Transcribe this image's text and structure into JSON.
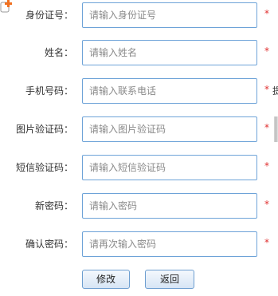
{
  "form": {
    "fields": [
      {
        "label": "身份证号：",
        "placeholder": "请输入身份证号",
        "required": "*"
      },
      {
        "label": "姓名：",
        "placeholder": "请输入姓名",
        "required": "*"
      },
      {
        "label": "手机号码：",
        "placeholder": "请输入联系电话",
        "required": "*",
        "hint": "提"
      },
      {
        "label": "图片验证码：",
        "placeholder": "请输入图片验证码",
        "required": "*"
      },
      {
        "label": "短信验证码：",
        "placeholder": "请输入短信验证码",
        "required": "*"
      },
      {
        "label": "新密码：",
        "placeholder": "请输入密码",
        "required": "*"
      },
      {
        "label": "确认密码：",
        "placeholder": "请再次输入密码",
        "required": "*"
      }
    ]
  },
  "buttons": {
    "submit": "修改",
    "back": "返回"
  },
  "colors": {
    "input_border": "#6ea3d8",
    "required": "#e03030",
    "button_border": "#6d9ed0",
    "corner_icon_accent": "#f07020"
  },
  "icons": {
    "corner": "edit-pencil-icon"
  }
}
